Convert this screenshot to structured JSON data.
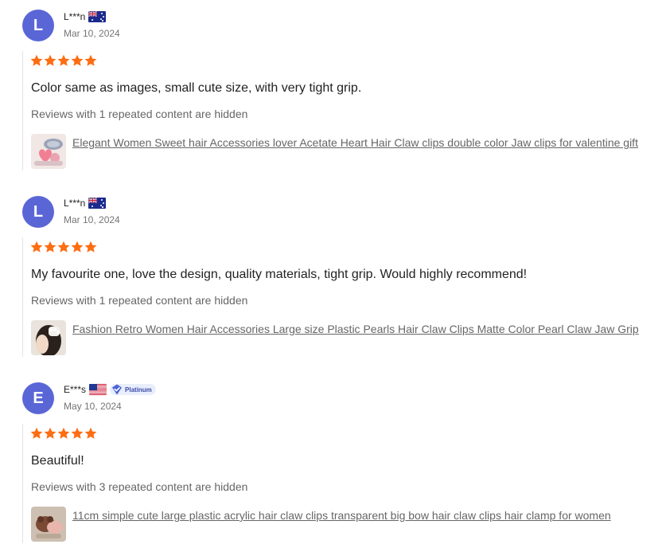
{
  "reviews": [
    {
      "avatar_letter": "L",
      "username": "L***n",
      "country_flag": "australia-flag",
      "date": "Mar 10, 2024",
      "rating": 5,
      "text": "Color same as images, small cute size, with very tight grip.",
      "hidden_note": "Reviews with 1 repeated content are hidden",
      "product_title": "Elegant Women Sweet hair Accessories lover Acetate Heart Hair Claw clips double color Jaw clips for valentine gift"
    },
    {
      "avatar_letter": "L",
      "username": "L***n",
      "country_flag": "australia-flag",
      "date": "Mar 10, 2024",
      "rating": 5,
      "text": "My favourite one, love the design, quality materials, tight grip. Would highly recommend!",
      "hidden_note": "Reviews with 1 repeated content are hidden",
      "product_title": "Fashion Retro Women Hair Accessories Large size Plastic Pearls Hair Claw Clips Matte Color Pearl Claw Jaw Grip"
    },
    {
      "avatar_letter": "E",
      "username": "E***s",
      "country_flag": "usa-flag",
      "badge": "Platinum",
      "date": "May 10, 2024",
      "rating": 5,
      "text": "Beautiful!",
      "hidden_note": "Reviews with 3 repeated content are hidden",
      "product_title": "11cm simple cute large plastic acrylic hair claw clips transparent big bow hair claw clips hair clamp for women"
    }
  ],
  "colors": {
    "avatar": "#5a66d6",
    "star": "#fd6d12",
    "badge_bg": "#e9eefc",
    "badge_text": "#3b4ba8"
  }
}
